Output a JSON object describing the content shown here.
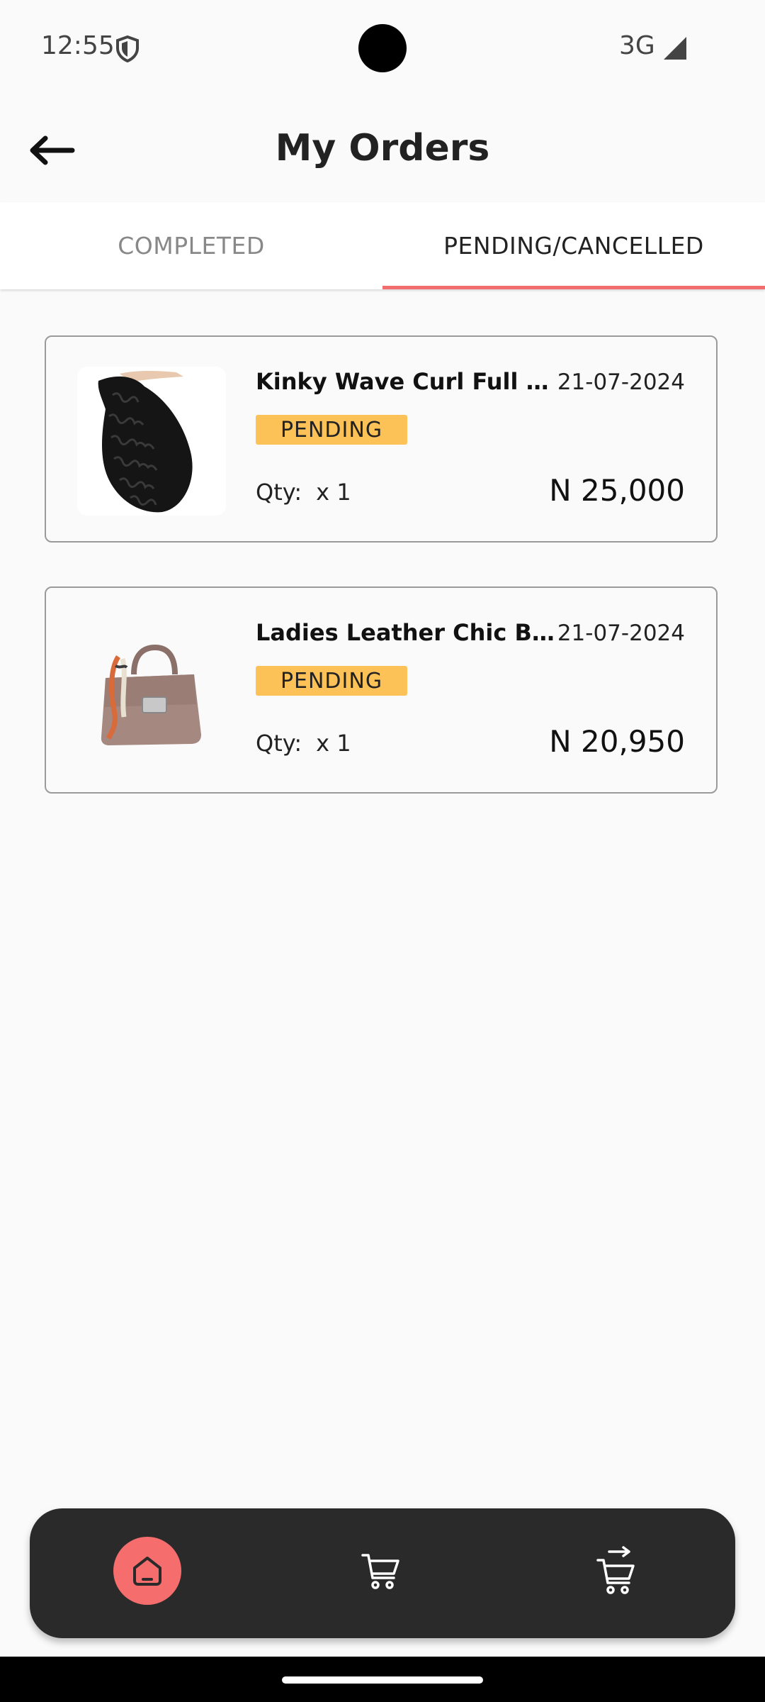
{
  "status_bar": {
    "time": "12:55",
    "network": "3G",
    "shield_icon": "shield-icon",
    "signal_icon": "signal-icon"
  },
  "header": {
    "title": "My Orders",
    "back_icon": "arrow-left-icon"
  },
  "tabs": [
    {
      "label": "COMPLETED",
      "active": false
    },
    {
      "label": "PENDING/CANCELLED",
      "active": true
    }
  ],
  "orders": [
    {
      "name": "Kinky Wave Curl Full Hai...",
      "date": "21-07-2024",
      "status": "PENDING",
      "qty_label": "Qty:",
      "qty_value": "x 1",
      "price": "N 25,000"
    },
    {
      "name": "Ladies Leather Chic Bag",
      "date": "21-07-2024",
      "status": "PENDING",
      "qty_label": "Qty:",
      "qty_value": "x 1",
      "price": "N 20,950"
    }
  ],
  "bottom_nav": [
    {
      "icon": "home-icon",
      "active": true
    },
    {
      "icon": "cart-icon",
      "active": false
    },
    {
      "icon": "order-cart-icon",
      "active": false
    }
  ],
  "colors": {
    "accent": "#f26d6d",
    "badge": "#fcc257",
    "nav_background": "#2a2a2a"
  }
}
